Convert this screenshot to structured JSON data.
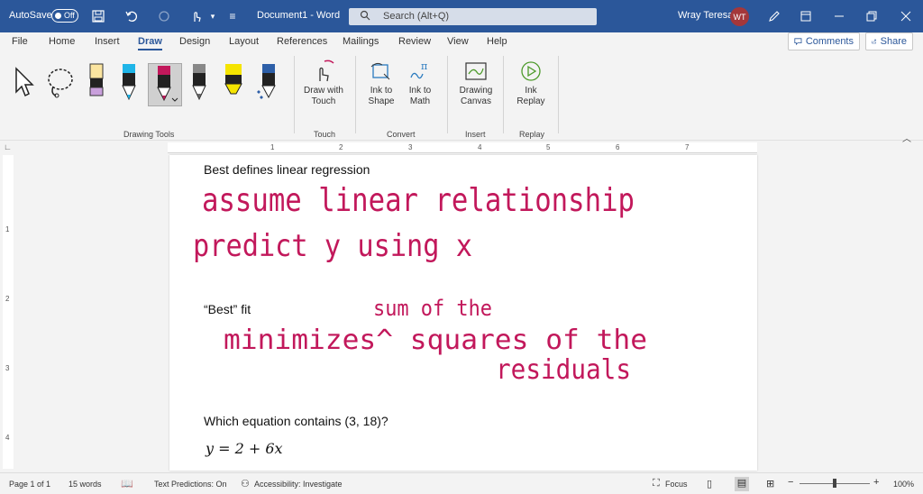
{
  "titlebar": {
    "autosave_label": "AutoSave",
    "autosave_state": "Off",
    "document_title": "Document1 - Word",
    "search_placeholder": "Search (Alt+Q)",
    "user_name": "Wray Teresa",
    "user_initials": "WT"
  },
  "menu": {
    "items": [
      "File",
      "Home",
      "Insert",
      "Draw",
      "Design",
      "Layout",
      "References",
      "Mailings",
      "Review",
      "View",
      "Help"
    ],
    "active": "Draw",
    "comments_label": "Comments",
    "share_label": "Share"
  },
  "ribbon": {
    "groups": {
      "drawing_tools": "Drawing Tools",
      "touch": "Touch",
      "convert": "Convert",
      "insert": "Insert",
      "replay": "Replay"
    },
    "buttons": {
      "draw_with_touch": "Draw with\nTouch",
      "ink_to_shape": "Ink to\nShape",
      "ink_to_math": "Ink to\nMath",
      "drawing_canvas": "Drawing\nCanvas",
      "ink_replay": "Ink\nReplay"
    },
    "pen_colors": {
      "highlighter_purple": "#c9a0dc",
      "pen_cyan": "#1fb5e8",
      "pen_magenta": "#c2185b",
      "pen_gray": "#888888",
      "highlighter_yellow": "#f5e400",
      "pen_galaxy": "#2d5fa8"
    }
  },
  "ruler": {
    "h_numbers": [
      "1",
      "2",
      "3",
      "4",
      "5",
      "6",
      "7"
    ],
    "v_numbers": [
      "1",
      "2",
      "3",
      "4"
    ]
  },
  "document": {
    "line1": "Best defines linear regression",
    "line2": "“Best” fit",
    "line3": "Which equation contains (3, 18)?",
    "equation": "y = 2 + 6x",
    "ink_color": "#c2185b",
    "ink_notes": {
      "note1": "assume linear relationship",
      "note2": "predict y using x",
      "note3": "sum of the",
      "note4": "minimizes^ squares of the",
      "note5": "residuals"
    }
  },
  "statusbar": {
    "page": "Page 1 of 1",
    "words": "15 words",
    "text_predictions": "Text Predictions: On",
    "accessibility": "Accessibility: Investigate",
    "focus": "Focus",
    "zoom": "100%"
  },
  "colors": {
    "titlebar": "#2b579a",
    "accent": "#2b579a"
  }
}
